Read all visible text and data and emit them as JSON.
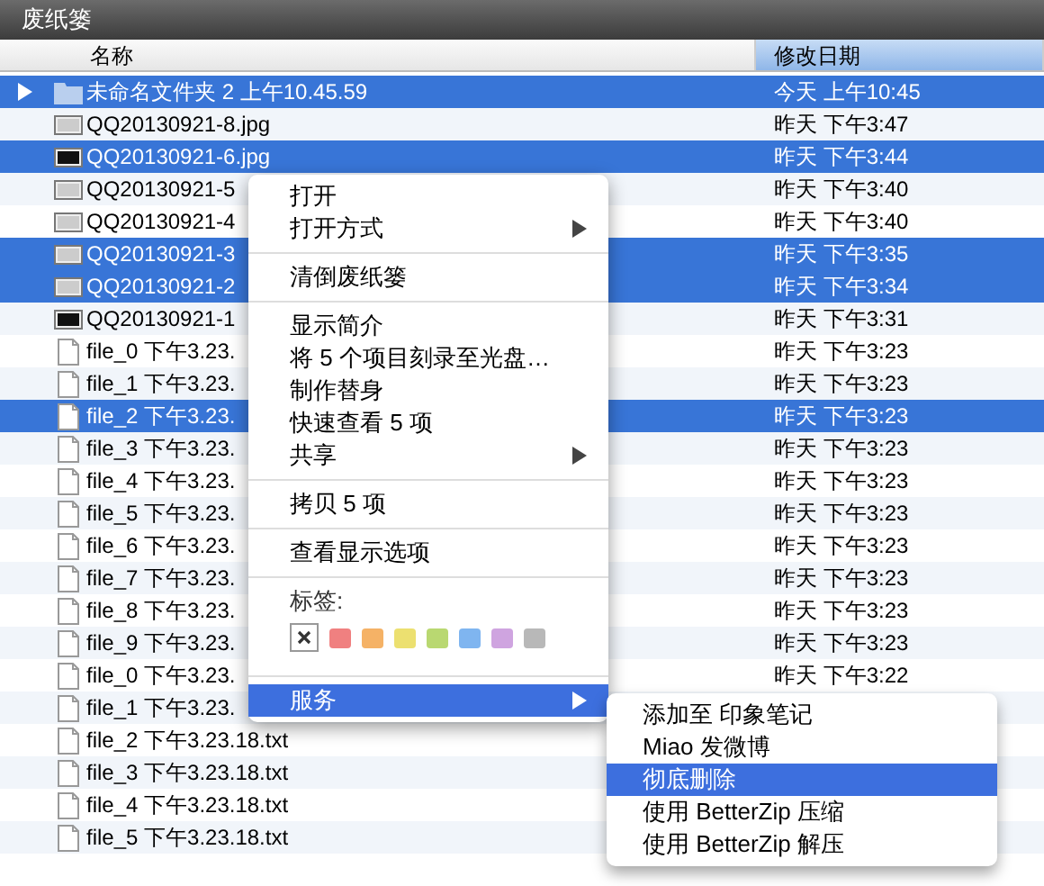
{
  "window": {
    "title": "废纸篓"
  },
  "columns": [
    {
      "label": "名称",
      "selected": false
    },
    {
      "label": "修改日期",
      "selected": true
    }
  ],
  "rows": [
    {
      "kind": "folder",
      "name": "未命名文件夹 2 上午10.45.59",
      "date": "今天 上午10:45",
      "selected": true,
      "expanded": false
    },
    {
      "kind": "image",
      "name": "QQ20130921-8.jpg",
      "date": "昨天 下午3:47",
      "selected": false
    },
    {
      "kind": "dark-image",
      "name": "QQ20130921-6.jpg",
      "date": "昨天 下午3:44",
      "selected": true
    },
    {
      "kind": "image",
      "name": "QQ20130921-5",
      "date": "昨天 下午3:40",
      "selected": false
    },
    {
      "kind": "image",
      "name": "QQ20130921-4",
      "date": "昨天 下午3:40",
      "selected": false
    },
    {
      "kind": "image",
      "name": "QQ20130921-3",
      "date": "昨天 下午3:35",
      "selected": true
    },
    {
      "kind": "image",
      "name": "QQ20130921-2",
      "date": "昨天 下午3:34",
      "selected": true
    },
    {
      "kind": "dark-image",
      "name": "QQ20130921-1",
      "date": "昨天 下午3:31",
      "selected": false
    },
    {
      "kind": "text",
      "name": "file_0 下午3.23.",
      "date": "昨天 下午3:23",
      "selected": false
    },
    {
      "kind": "text",
      "name": "file_1 下午3.23.",
      "date": "昨天 下午3:23",
      "selected": false
    },
    {
      "kind": "text",
      "name": "file_2 下午3.23.",
      "date": "昨天 下午3:23",
      "selected": true
    },
    {
      "kind": "text",
      "name": "file_3 下午3.23.",
      "date": "昨天 下午3:23",
      "selected": false
    },
    {
      "kind": "text",
      "name": "file_4 下午3.23.",
      "date": "昨天 下午3:23",
      "selected": false
    },
    {
      "kind": "text",
      "name": "file_5 下午3.23.",
      "date": "昨天 下午3:23",
      "selected": false
    },
    {
      "kind": "text",
      "name": "file_6 下午3.23.",
      "date": "昨天 下午3:23",
      "selected": false
    },
    {
      "kind": "text",
      "name": "file_7 下午3.23.",
      "date": "昨天 下午3:23",
      "selected": false
    },
    {
      "kind": "text",
      "name": "file_8 下午3.23.",
      "date": "昨天 下午3:23",
      "selected": false
    },
    {
      "kind": "text",
      "name": "file_9 下午3.23.",
      "date": "昨天 下午3:23",
      "selected": false
    },
    {
      "kind": "text",
      "name": "file_0 下午3.23.",
      "date": "昨天 下午3:22",
      "selected": false
    },
    {
      "kind": "text",
      "name": "file_1 下午3.23.",
      "selected": false
    },
    {
      "kind": "text",
      "name": "file_2 下午3.23.18.txt",
      "selected": false
    },
    {
      "kind": "text",
      "name": "file_3 下午3.23.18.txt",
      "selected": false
    },
    {
      "kind": "text",
      "name": "file_4 下午3.23.18.txt",
      "selected": false
    },
    {
      "kind": "text",
      "name": "file_5 下午3.23.18.txt",
      "selected": false
    }
  ],
  "context_menu": {
    "items": [
      {
        "kind": "item",
        "label": "打开",
        "selected": false,
        "submenu": false
      },
      {
        "kind": "item",
        "label": "打开方式",
        "selected": false,
        "submenu": true
      },
      {
        "kind": "separator"
      },
      {
        "kind": "item",
        "label": "清倒废纸篓",
        "selected": false,
        "submenu": false
      },
      {
        "kind": "separator"
      },
      {
        "kind": "item",
        "label": "显示简介",
        "selected": false,
        "submenu": false
      },
      {
        "kind": "item",
        "label": "将 5 个项目刻录至光盘…",
        "selected": false,
        "submenu": false
      },
      {
        "kind": "item",
        "label": "制作替身",
        "selected": false,
        "submenu": false
      },
      {
        "kind": "item",
        "label": "快速查看 5 项",
        "selected": false,
        "submenu": false
      },
      {
        "kind": "item",
        "label": "共享",
        "selected": false,
        "submenu": true
      },
      {
        "kind": "separator"
      },
      {
        "kind": "item",
        "label": "拷贝 5 项",
        "selected": false,
        "submenu": false
      },
      {
        "kind": "separator"
      },
      {
        "kind": "item",
        "label": "查看显示选项",
        "selected": false,
        "submenu": false
      },
      {
        "kind": "separator"
      },
      {
        "kind": "heading",
        "label": "标签:"
      },
      {
        "kind": "tags",
        "tags": [
          {
            "color": "#f08080"
          },
          {
            "color": "#f5b266"
          },
          {
            "color": "#ece070"
          },
          {
            "color": "#b9d871"
          },
          {
            "color": "#7fb5f0"
          },
          {
            "color": "#cfa4e0"
          },
          {
            "color": "#b8b8b8"
          }
        ]
      },
      {
        "kind": "separator"
      },
      {
        "kind": "item",
        "label": "服务",
        "selected": true,
        "submenu": true
      }
    ]
  },
  "services_menu": {
    "items": [
      {
        "label": "添加至 印象笔记",
        "selected": false
      },
      {
        "label": "Miao 发微博",
        "selected": false
      },
      {
        "label": "彻底删除",
        "selected": true
      },
      {
        "label": "使用 BetterZip 压缩",
        "selected": false
      },
      {
        "label": "使用 BetterZip 解压",
        "selected": false
      }
    ]
  }
}
